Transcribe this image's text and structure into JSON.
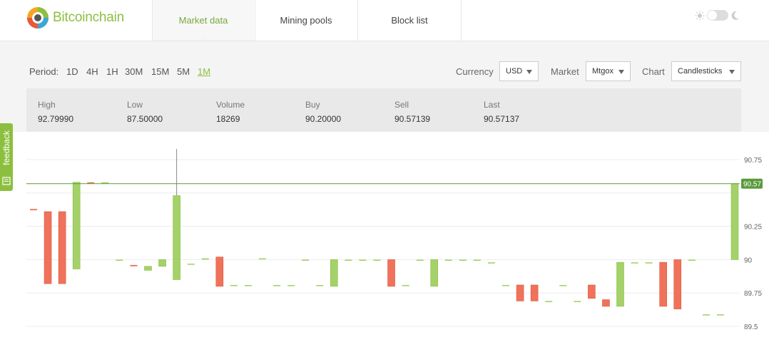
{
  "brand": {
    "name": "Bitcoinchain"
  },
  "nav": {
    "tabs": [
      {
        "label": "Market data"
      },
      {
        "label": "Mining pools"
      },
      {
        "label": "Block list"
      }
    ],
    "active_index": 0
  },
  "theme": {
    "sun_icon": "sun-icon",
    "moon_icon": "moon-icon"
  },
  "controls": {
    "period_label": "Period:",
    "periods": [
      "1D",
      "4H",
      "1H",
      "30M",
      "15M",
      "5M",
      "1M"
    ],
    "active_period": "1M",
    "currency": {
      "label": "Currency",
      "value": "USD"
    },
    "market": {
      "label": "Market",
      "value": "Mtgox"
    },
    "chart": {
      "label": "Chart",
      "value": "Candlesticks"
    }
  },
  "stats": [
    {
      "label": "High",
      "value": "92.79990"
    },
    {
      "label": "Low",
      "value": "87.50000"
    },
    {
      "label": "Volume",
      "value": "18269"
    },
    {
      "label": "Buy",
      "value": "90.20000"
    },
    {
      "label": "Sell",
      "value": "90.57139"
    },
    {
      "label": "Last",
      "value": "90.57137"
    }
  ],
  "feedback": {
    "label": "feedback"
  },
  "colors": {
    "up": "#a4d169",
    "down": "#f0725a",
    "accent": "#8cbf3f",
    "price_line": "#5a9a3a"
  },
  "chart_data": {
    "type": "candlestick",
    "y_ticks": [
      90.75,
      90.5,
      90.25,
      90,
      89.75,
      89.5
    ],
    "y_tick_labels": [
      "90.75",
      "",
      "90.25",
      "90",
      "89.75",
      "89.5"
    ],
    "ylim": [
      89.45,
      91.05
    ],
    "current_price": 90.57,
    "current_price_label": "90.57",
    "candles": [
      {
        "o": 90.38,
        "c": 90.37
      },
      {
        "o": 90.36,
        "c": 89.82
      },
      {
        "o": 90.36,
        "c": 89.82
      },
      {
        "o": 89.93,
        "c": 90.58
      },
      {
        "o": 90.58,
        "c": 90.57
      },
      {
        "o": 90.58,
        "c": 90.58
      },
      {
        "o": 90.0,
        "c": 90.0
      },
      {
        "o": 89.96,
        "c": 89.95
      },
      {
        "o": 89.92,
        "c": 89.95
      },
      {
        "o": 89.95,
        "c": 90.0
      },
      {
        "o": 89.85,
        "c": 90.48,
        "h": 90.83
      },
      {
        "o": 89.97,
        "c": 89.97
      },
      {
        "o": 90.0,
        "c": 90.01
      },
      {
        "o": 90.02,
        "c": 89.8
      },
      {
        "o": 89.81,
        "c": 89.81
      },
      {
        "o": 89.81,
        "c": 89.81
      },
      {
        "o": 90.01,
        "c": 90.01
      },
      {
        "o": 89.81,
        "c": 89.81
      },
      {
        "o": 89.81,
        "c": 89.81
      },
      {
        "o": 90.0,
        "c": 90.0
      },
      {
        "o": 89.81,
        "c": 89.81
      },
      {
        "o": 89.8,
        "c": 90.0
      },
      {
        "o": 90.0,
        "c": 90.0
      },
      {
        "o": 90.0,
        "c": 90.0
      },
      {
        "o": 90.0,
        "c": 90.0
      },
      {
        "o": 90.0,
        "c": 89.8
      },
      {
        "o": 89.81,
        "c": 89.81
      },
      {
        "o": 90.0,
        "c": 90.0
      },
      {
        "o": 89.8,
        "c": 90.0
      },
      {
        "o": 90.0,
        "c": 90.0
      },
      {
        "o": 90.0,
        "c": 90.0
      },
      {
        "o": 90.0,
        "c": 90.0
      },
      {
        "o": 89.98,
        "c": 89.98
      },
      {
        "o": 89.81,
        "c": 89.81
      },
      {
        "o": 89.81,
        "c": 89.69
      },
      {
        "o": 89.81,
        "c": 89.69
      },
      {
        "o": 89.69,
        "c": 89.69
      },
      {
        "o": 89.81,
        "c": 89.81
      },
      {
        "o": 89.69,
        "c": 89.69
      },
      {
        "o": 89.81,
        "c": 89.71
      },
      {
        "o": 89.7,
        "c": 89.65
      },
      {
        "o": 89.65,
        "c": 89.98
      },
      {
        "o": 89.98,
        "c": 89.98
      },
      {
        "o": 89.98,
        "c": 89.98
      },
      {
        "o": 89.98,
        "c": 89.65
      },
      {
        "o": 90.0,
        "c": 89.63
      },
      {
        "o": 90.0,
        "c": 90.0
      },
      {
        "o": 89.59,
        "c": 89.59
      },
      {
        "o": 89.59,
        "c": 89.59
      },
      {
        "o": 90.0,
        "c": 90.57
      }
    ]
  }
}
